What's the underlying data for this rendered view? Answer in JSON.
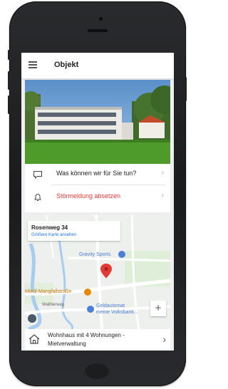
{
  "app": {
    "title": "Objekt"
  },
  "actions": {
    "contact_label": "Was können wir für Sie tun?",
    "report_label": "Störmeldung absetzen"
  },
  "map": {
    "address": "Rosenweg 34",
    "larger_map_link": "Größere Karte ansehen",
    "poi_gravity": "Gravity Sports",
    "poi_street": "Miedl-Mangfallstraße",
    "poi_wall": "Wallberweg",
    "poi_atm_line1": "Geldautomat",
    "poi_atm_line2": "meine Volksbank...",
    "zoom_in": "+"
  },
  "property": {
    "line1": "Wohnhaus mit 4 Wohnungen -",
    "line2": "Mietverwaltung"
  },
  "colors": {
    "accent_red": "#e53935",
    "link_blue": "#1a73e8",
    "poi_orange": "#e8890c",
    "poi_blue": "#4a7fd9"
  },
  "icons": {
    "menu": "hamburger-icon",
    "chat": "chat-bubble-icon",
    "bell": "bell-icon",
    "home": "house-icon",
    "pin": "map-pin-icon"
  }
}
